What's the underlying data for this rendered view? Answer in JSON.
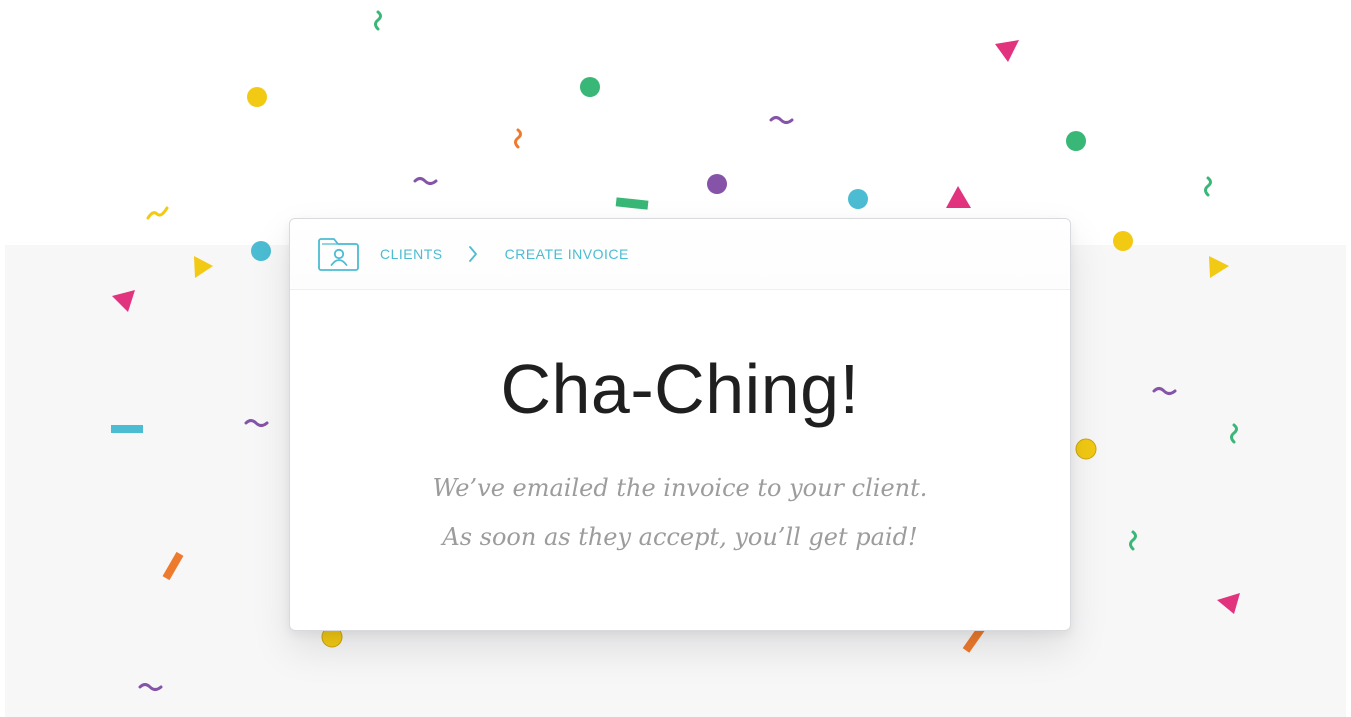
{
  "breadcrumb": {
    "items": [
      {
        "label": "CLIENTS"
      },
      {
        "label": "CREATE INVOICE"
      }
    ],
    "icon": "client-folder-icon",
    "separator_icon": "chevron-right-icon"
  },
  "message": {
    "title": "Cha-Ching!",
    "lines": [
      "We’ve emailed the invoice to your client.",
      "As soon as they accept, you’ll get paid!"
    ]
  },
  "colors": {
    "accent": "#4bbcd2",
    "title": "#1f1f1f",
    "subtitle": "#9c9c9c",
    "confetti": [
      "#f2c913",
      "#38b777",
      "#8553a8",
      "#e2337f",
      "#4bbcd2",
      "#ee7a2d"
    ]
  }
}
